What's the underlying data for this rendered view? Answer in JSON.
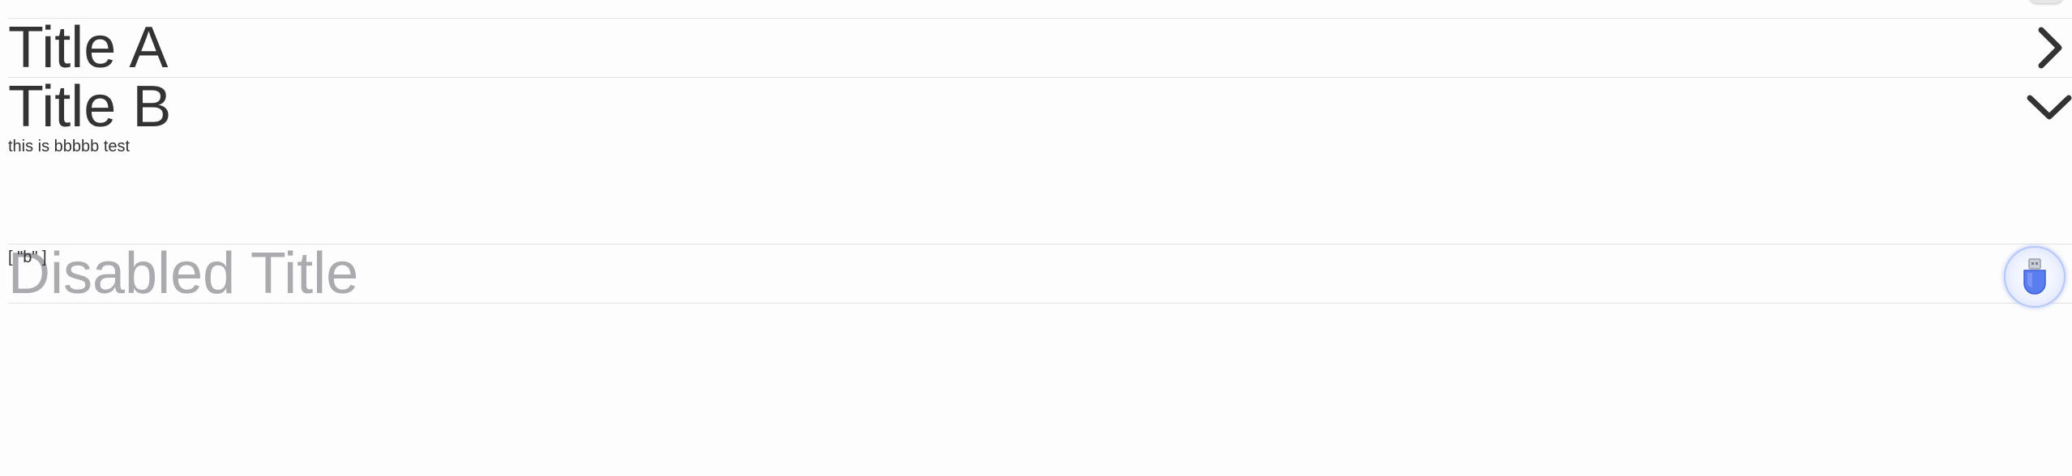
{
  "accordion": {
    "items": [
      {
        "title": "Title A",
        "expanded": false,
        "disabled": false,
        "content": "",
        "icon": "chevron-right-icon"
      },
      {
        "title": "Title B",
        "expanded": true,
        "disabled": false,
        "content": "this is bbbbb test",
        "icon": "chevron-down-icon"
      },
      {
        "title": "Disabled Title",
        "expanded": false,
        "disabled": true,
        "content": "",
        "icon": "chevron-right-icon"
      }
    ]
  },
  "output": {
    "value": "[ \"b\" ]"
  },
  "devtools": {
    "icon": "usb-plug-icon"
  },
  "colors": {
    "text": "#333333",
    "disabled_text": "#aaaaaf",
    "divider": "#e2e2e2",
    "chevron": "#333333",
    "chevron_disabled": "#aaaaaf",
    "fab_accent": "#5a7df0"
  }
}
